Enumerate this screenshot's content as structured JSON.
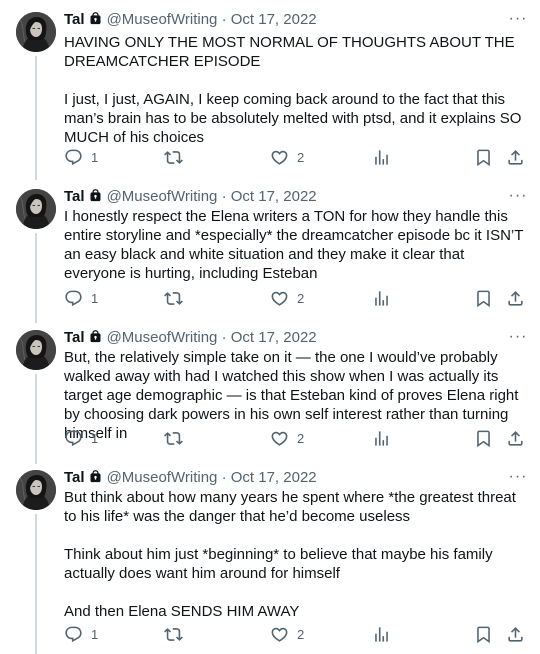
{
  "author": {
    "name": "Tal",
    "handle": "@MuseofWriting",
    "separator": "·",
    "date": "Oct 17, 2022"
  },
  "icons": {
    "lock": "lock-icon",
    "more": "more-icon",
    "reply": "reply-icon",
    "retweet": "retweet-icon",
    "like": "like-icon",
    "views": "views-icon",
    "bookmark": "bookmark-icon",
    "share": "share-icon"
  },
  "colors": {
    "text": "#0f1419",
    "secondary": "#536471",
    "thread_line": "#cfd9de"
  },
  "tweets": [
    {
      "paragraphs": [
        "HAVING ONLY THE MOST NORMAL OF THOUGHTS ABOUT THE DREAMCATCHER EPISODE",
        "I just, I just, AGAIN, I keep coming back around to the fact that this man’s brain has to be absolutely melted with ptsd, and it explains SO MUCH of his choices"
      ],
      "replies": "1",
      "retweets": "",
      "likes": "2"
    },
    {
      "paragraphs": [
        "I honestly respect the Elena writers a TON for how they handle this entire storyline and *especially* the dreamcatcher episode bc it ISN’T an easy black and white situation and they make it clear that everyone is hurting, including Esteban"
      ],
      "replies": "1",
      "retweets": "",
      "likes": "2"
    },
    {
      "paragraphs": [
        "But, the relatively simple take on it — the one I would’ve probably walked away with had I watched this show when I was actually its target age demographic — is that Esteban kind of proves Elena right by choosing dark powers in his own self interest rather than turning himself in"
      ],
      "replies": "1",
      "retweets": "",
      "likes": "2"
    },
    {
      "paragraphs": [
        "But think about how many years he spent where *the greatest threat to his life* was the danger that he’d become useless",
        "Think about him just *beginning* to believe that maybe his family actually does want him around for himself",
        "And then Elena SENDS HIM AWAY"
      ],
      "replies": "1",
      "retweets": "",
      "likes": "2"
    }
  ]
}
